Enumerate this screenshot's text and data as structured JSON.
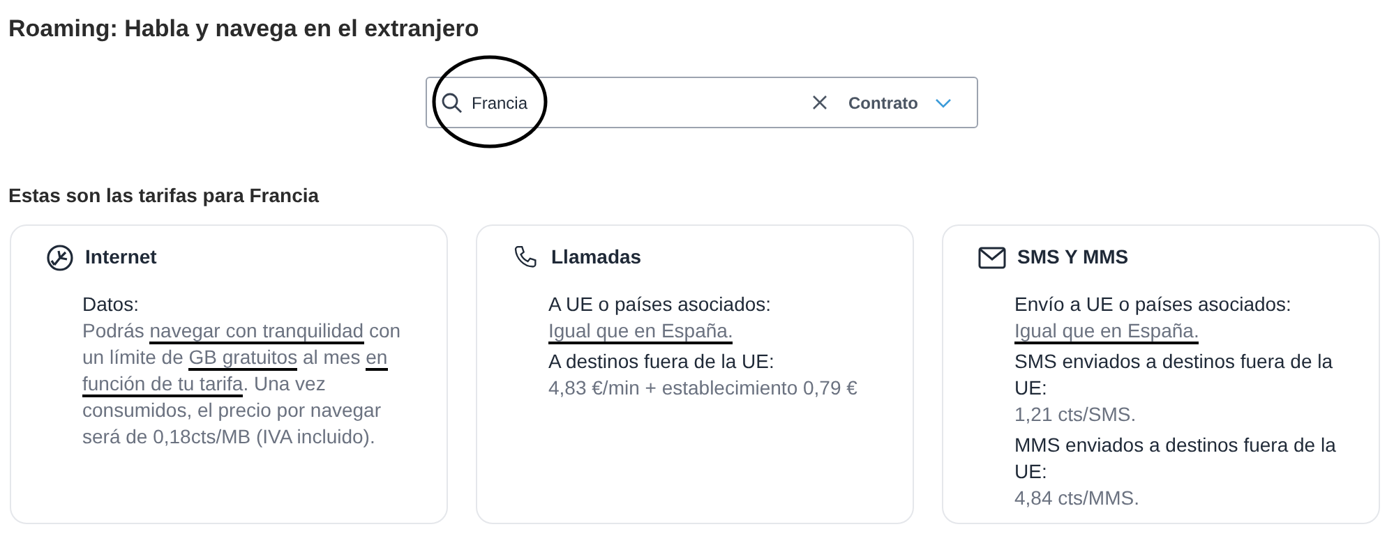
{
  "title": "Roaming: Habla y navega en el extranjero",
  "search": {
    "value": "Francia",
    "filter": "Contrato",
    "circled": true
  },
  "section_label": "Estas son las tarifas para Francia",
  "cards": [
    {
      "kind": "internet",
      "title": "Internet",
      "blocks": [
        {
          "label": "Datos:",
          "value": [
            {
              "text": "Podrás ",
              "underlined": false
            },
            {
              "text": "navegar con tranquilidad",
              "underlined": true
            },
            {
              "text": " con un límite de ",
              "underlined": false
            },
            {
              "text": "GB gratuitos",
              "underlined": true
            },
            {
              "text": " al mes ",
              "underlined": false
            },
            {
              "text": "en función de tu tarifa",
              "underlined": true
            },
            {
              "text": ". Una vez consumidos, el precio por navegar será de 0,18cts/MB (IVA incluido).",
              "underlined": false
            }
          ]
        }
      ]
    },
    {
      "kind": "calls",
      "title": "Llamadas",
      "blocks": [
        {
          "label": "A UE o países asociados:",
          "value": [
            {
              "text": "Igual que en España.",
              "underlined": true
            }
          ]
        },
        {
          "label": "A destinos fuera de la UE:",
          "value": [
            {
              "text": "4,83 €/min + establecimiento 0,79 €",
              "underlined": false
            }
          ]
        }
      ]
    },
    {
      "kind": "messages",
      "title": "SMS Y MMS",
      "blocks": [
        {
          "label": "Envío a UE o países asociados:",
          "value": [
            {
              "text": "Igual que en España.",
              "underlined": true
            }
          ]
        },
        {
          "label": "SMS enviados a destinos fuera de la UE:",
          "value": [
            {
              "text": "1,21 cts/SMS.",
              "underlined": false
            }
          ]
        },
        {
          "label": "MMS enviados a destinos fuera de la UE:",
          "value": [
            {
              "text": "4,84 cts/MMS.",
              "underlined": false
            }
          ]
        }
      ]
    }
  ]
}
